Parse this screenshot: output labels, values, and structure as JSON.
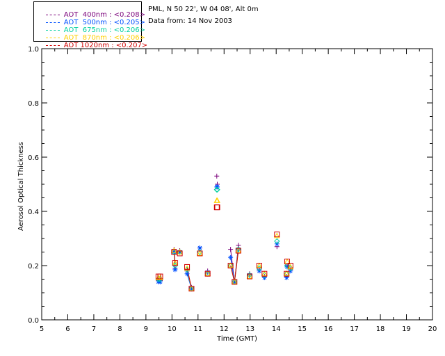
{
  "header": {
    "site": "PML, N 50 22', W 04 08', Alt 0m",
    "date": "Data from: 14 Nov 2003"
  },
  "legend": [
    {
      "label": "AOT  400nm : <0.208>",
      "color": "#7a007a"
    },
    {
      "label": "AOT  500nm : <0.205>",
      "color": "#0050ff"
    },
    {
      "label": "AOT  675nm : <0.206>",
      "color": "#00d0a0"
    },
    {
      "label": "AOT  870nm : <0.206>",
      "color": "#ffd000"
    },
    {
      "label": "AOT 1020nm : <0.207>",
      "color": "#d00000"
    }
  ],
  "chart_data": {
    "type": "scatter",
    "title": "",
    "xlabel": "Time (GMT)",
    "ylabel": "Aerosol Optical Thickness",
    "xlim": [
      5,
      20
    ],
    "ylim": [
      0,
      1.0
    ],
    "xticks": [
      5,
      6,
      7,
      8,
      9,
      10,
      11,
      12,
      13,
      14,
      15,
      16,
      17,
      18,
      19,
      20
    ],
    "yticks": [
      "0.0",
      "0.2",
      "0.4",
      "0.6",
      "0.8",
      "1.0"
    ],
    "grid": false,
    "x": [
      9.48,
      9.55,
      10.08,
      10.12,
      10.3,
      10.58,
      10.75,
      11.07,
      11.37,
      11.72,
      11.74,
      12.25,
      12.4,
      12.55,
      12.98,
      13.35,
      13.55,
      14.03,
      14.4,
      14.42,
      14.55
    ],
    "series": [
      {
        "name": "AOT  400nm : <0.208>",
        "marker": "plus",
        "color": "#7a007a",
        "values": [
          0.145,
          0.145,
          0.26,
          0.19,
          0.255,
          0.18,
          0.12,
          0.265,
          0.18,
          0.53,
          0.5,
          0.26,
          0.14,
          0.275,
          0.17,
          0.185,
          0.16,
          0.27,
          0.16,
          0.2,
          0.185
        ]
      },
      {
        "name": "AOT  500nm : <0.205>",
        "marker": "star",
        "color": "#0050ff",
        "values": [
          0.14,
          0.14,
          0.25,
          0.185,
          0.25,
          0.17,
          0.115,
          0.265,
          0.175,
          0.49,
          0.49,
          0.23,
          0.14,
          0.26,
          0.165,
          0.18,
          0.155,
          0.28,
          0.155,
          0.195,
          0.18
        ]
      },
      {
        "name": "AOT  675nm : <0.206>",
        "marker": "diamond",
        "color": "#00d0a0",
        "values": [
          0.15,
          0.15,
          0.25,
          0.2,
          0.25,
          0.185,
          0.115,
          0.25,
          0.17,
          0.48,
          0.48,
          0.2,
          0.14,
          0.26,
          0.165,
          0.19,
          0.165,
          0.29,
          0.17,
          0.2,
          0.19
        ]
      },
      {
        "name": "AOT  870nm : <0.206>",
        "marker": "triangle",
        "color": "#ffd000",
        "values": [
          0.155,
          0.155,
          0.255,
          0.21,
          0.25,
          0.19,
          0.115,
          0.245,
          0.17,
          0.44,
          0.44,
          0.2,
          0.14,
          0.255,
          0.16,
          0.2,
          0.17,
          0.31,
          0.17,
          0.215,
          0.195
        ]
      },
      {
        "name": "AOT 1020nm : <0.207>",
        "marker": "square",
        "color": "#d00000",
        "values": [
          0.16,
          0.16,
          0.25,
          0.21,
          0.245,
          0.195,
          0.115,
          0.245,
          0.17,
          0.415,
          0.415,
          0.2,
          0.14,
          0.255,
          0.16,
          0.2,
          0.17,
          0.315,
          0.17,
          0.215,
          0.2
        ]
      }
    ],
    "connections": [
      [
        2,
        3
      ],
      [
        5,
        6
      ],
      [
        11,
        12
      ],
      [
        12,
        13
      ]
    ]
  }
}
